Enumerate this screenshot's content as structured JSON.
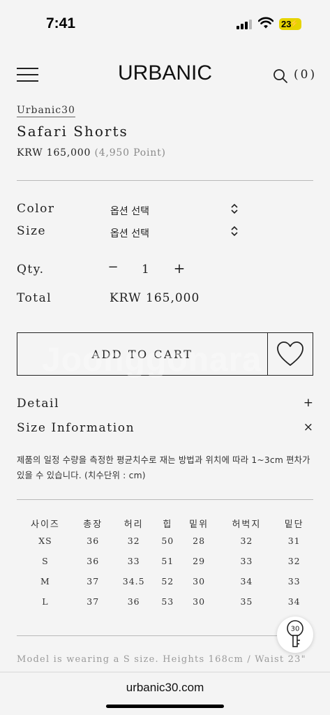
{
  "status_bar": {
    "time": "7:41",
    "battery": "23"
  },
  "header": {
    "logo": "URBANIC",
    "cart_count": "(0)"
  },
  "product": {
    "brand": "Urbanic30",
    "name": "Safari Shorts",
    "price": "KRW 165,000",
    "points": "(4,950 Point)"
  },
  "options": {
    "color_label": "Color",
    "color_value": "옵션 선택",
    "size_label": "Size",
    "size_value": "옵션 선택",
    "qty_label": "Qty.",
    "qty_minus": "−",
    "qty_value": "1",
    "qty_plus": "+",
    "total_label": "Total",
    "total_value": "KRW 165,000"
  },
  "actions": {
    "add_to_cart": "ADD TO CART",
    "watermark": "Joonggonara"
  },
  "accordion": {
    "detail_label": "Detail",
    "detail_symbol": "+",
    "size_info_label": "Size Information",
    "size_info_symbol": "×"
  },
  "size_info": {
    "description": "제품의 일정 수량을 측정한 평균치수로 재는 방법과 위치에 따라 1~3cm 편차가 있을 수 있습니다. (치수단위 : cm)",
    "columns": [
      "사이즈",
      "총장",
      "허리",
      "힙",
      "밑위",
      "허벅지",
      "밑단"
    ],
    "rows": [
      [
        "XS",
        "36",
        "32",
        "50",
        "28",
        "32",
        "31"
      ],
      [
        "S",
        "36",
        "33",
        "51",
        "29",
        "33",
        "32"
      ],
      [
        "M",
        "37",
        "34.5",
        "52",
        "30",
        "34",
        "33"
      ],
      [
        "L",
        "37",
        "36",
        "53",
        "30",
        "35",
        "34"
      ]
    ],
    "model_note": "Model is wearing a S size. Heights 168cm / Waist 23\""
  },
  "floating_button": {
    "label": "30"
  },
  "browser": {
    "url": "urbanic30.com"
  },
  "icons": {
    "menu": "hamburger-menu-icon",
    "search": "search-icon",
    "select": "chevron-up-down-icon",
    "wishlist": "heart-icon",
    "floating": "key-icon"
  }
}
